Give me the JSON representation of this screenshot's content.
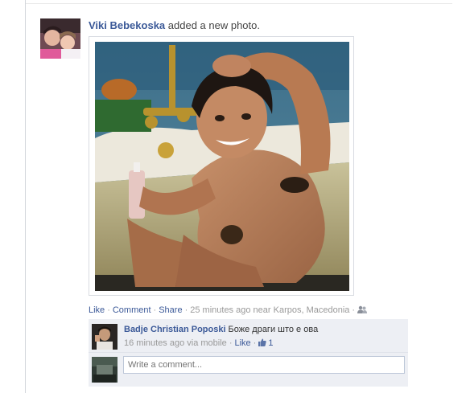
{
  "post": {
    "author": "Viki Bebekoska",
    "action": "added a new photo."
  },
  "meta": {
    "like": "Like",
    "comment": "Comment",
    "share": "Share",
    "time": "25 minutes ago",
    "near": "near",
    "location": "Karpos, Macedonia"
  },
  "comment": {
    "author": "Badje Christian Poposki",
    "text": "Боже драги што е ова",
    "time": "16 minutes ago",
    "via": "via mobile",
    "like": "Like",
    "like_count": "1"
  },
  "composer": {
    "placeholder": "Write a comment..."
  },
  "colors": {
    "link": "#3b5998",
    "comment_bg": "#edeff4",
    "muted": "#999999"
  },
  "icons": {
    "audience": "friends-icon",
    "like_count": "thumbs-up-icon"
  }
}
